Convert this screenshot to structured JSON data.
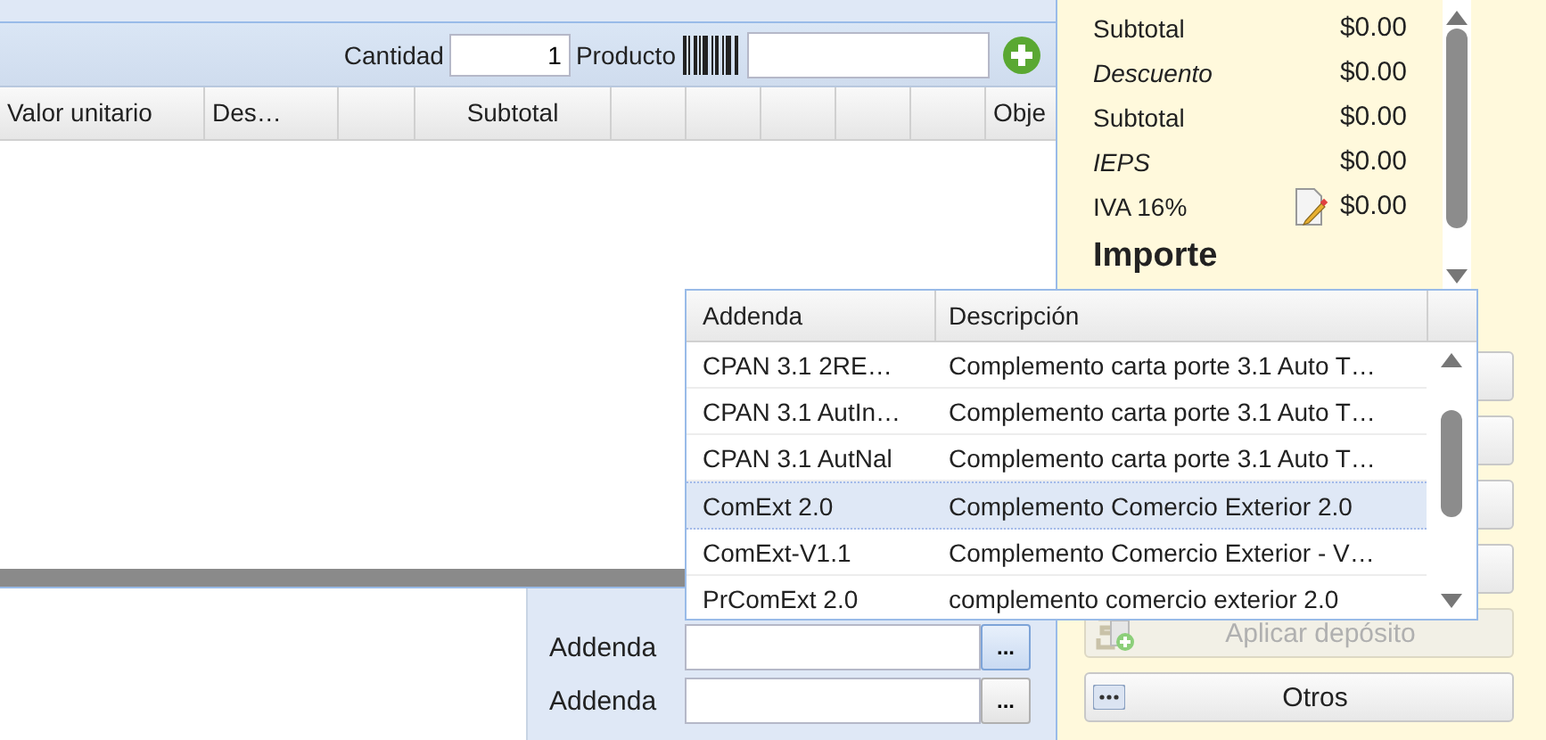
{
  "toolbar": {
    "quantity_label": "Cantidad",
    "quantity": "1",
    "product_label": "Producto"
  },
  "grid": {
    "columns": [
      {
        "label": "Valor unitario"
      },
      {
        "label": "Des…"
      },
      {},
      {
        "label": "Subtotal"
      },
      {},
      {},
      {},
      {},
      {},
      {
        "label": "Obje"
      }
    ]
  },
  "totals": {
    "rows": [
      {
        "label": "Subtotal",
        "value": "$0.00",
        "kind": "plain"
      },
      {
        "label": "Descuento",
        "value": "$0.00",
        "kind": "italic"
      },
      {
        "label": "Subtotal",
        "value": "$0.00",
        "kind": "plain"
      },
      {
        "label": "IEPS",
        "value": "$0.00",
        "kind": "italic"
      },
      {
        "label": "IVA 16%",
        "value": "$0.00",
        "kind": "editable"
      }
    ],
    "heading": "Importe"
  },
  "addenda_popup": {
    "columns": [
      "Addenda",
      "Descripción"
    ],
    "rows": [
      {
        "addenda": "CPAN 3.1 2RE…",
        "description": "Complemento carta porte 3.1 Auto T…",
        "selected": false
      },
      {
        "addenda": "CPAN 3.1 AutIn…",
        "description": "Complemento carta porte 3.1 Auto T…",
        "selected": false
      },
      {
        "addenda": "CPAN 3.1 AutNal",
        "description": "Complemento carta porte 3.1 Auto T…",
        "selected": false
      },
      {
        "addenda": "ComExt 2.0",
        "description": "Complemento Comercio Exterior 2.0",
        "selected": true
      },
      {
        "addenda": "ComExt-V1.1",
        "description": "Complemento Comercio Exterior - V…",
        "selected": false
      },
      {
        "addenda": "PrComExt 2.0",
        "description": "complemento comercio exterior 2.0",
        "selected": false
      }
    ]
  },
  "addenda_fields": [
    {
      "label": "Addenda",
      "button": "...",
      "hover": true
    },
    {
      "label": "Addenda",
      "button": "...",
      "hover": false
    }
  ],
  "actions": [
    {
      "label": "Aplicar depósito",
      "disabled": true
    },
    {
      "label": "Otros",
      "disabled": false
    }
  ]
}
